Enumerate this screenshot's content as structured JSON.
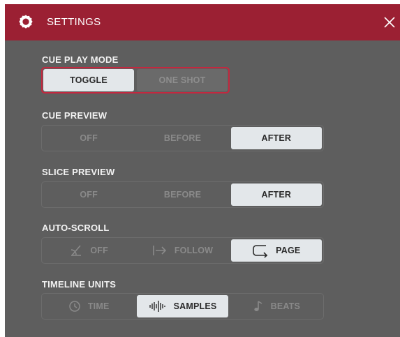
{
  "header": {
    "title": "SETTINGS",
    "icon": "gear-icon",
    "close_icon": "close-icon",
    "bg_color": "#9b2033"
  },
  "sections": {
    "cue_play_mode": {
      "label": "CUE PLAY MODE",
      "options": [
        "TOGGLE",
        "ONE SHOT"
      ],
      "selected": "TOGGLE"
    },
    "cue_preview": {
      "label": "CUE PREVIEW",
      "options": [
        "OFF",
        "BEFORE",
        "AFTER"
      ],
      "selected": "AFTER"
    },
    "slice_preview": {
      "label": "SLICE PREVIEW",
      "options": [
        "OFF",
        "BEFORE",
        "AFTER"
      ],
      "selected": "AFTER"
    },
    "auto_scroll": {
      "label": "AUTO-SCROLL",
      "options": [
        "OFF",
        "FOLLOW",
        "PAGE"
      ],
      "icons": [
        "scroll-off-icon",
        "follow-arrow-icon",
        "page-wrap-icon"
      ],
      "selected": "PAGE"
    },
    "timeline_units": {
      "label": "TIMELINE UNITS",
      "options": [
        "TIME",
        "SAMPLES",
        "BEATS"
      ],
      "icons": [
        "clock-icon",
        "waveform-icon",
        "note-icon"
      ],
      "selected": "SAMPLES"
    }
  },
  "colors": {
    "panel": "#5e5e5e",
    "selected": "#e3e7ea",
    "focus_border": "#c4283f"
  }
}
